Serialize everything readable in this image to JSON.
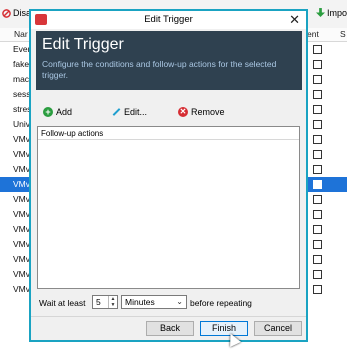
{
  "background_app": {
    "toolbar": {
      "disable_label": "Disa",
      "import_label": "Impor"
    },
    "columns": {
      "name": "Nar",
      "event": "ent",
      "s": "S"
    },
    "rows": [
      {
        "name": "Ever"
      },
      {
        "name": "fake"
      },
      {
        "name": "mac"
      },
      {
        "name": "sess"
      },
      {
        "name": "stres"
      },
      {
        "name": "Univ"
      },
      {
        "name": "VMv"
      },
      {
        "name": "VMv"
      },
      {
        "name": "VMv"
      },
      {
        "name": "VMv"
      },
      {
        "name": "VMv"
      },
      {
        "name": "VMv"
      },
      {
        "name": "VMv"
      },
      {
        "name": "VMv"
      },
      {
        "name": "VMv"
      },
      {
        "name": "VMv"
      },
      {
        "name": "VMv"
      }
    ],
    "selected_row": 9
  },
  "dialog": {
    "window_title": "Edit Trigger",
    "banner": {
      "title": "Edit Trigger",
      "subtitle": "Configure the conditions and follow-up actions for the selected trigger."
    },
    "toolbar": {
      "add_label": "Add",
      "edit_label": "Edit...",
      "remove_label": "Remove"
    },
    "list": {
      "header": "Follow-up actions"
    },
    "wait": {
      "prefix": "Wait at least",
      "value": "5",
      "unit": "Minutes",
      "suffix": "before repeating"
    },
    "buttons": {
      "back": "Back",
      "finish": "Finish",
      "cancel": "Cancel"
    }
  },
  "colors": {
    "dialog_border": "#1aa3c2",
    "banner_bg": "#2f4150",
    "banner_subtitle": "#aac7e3",
    "selection": "#1e73d8"
  }
}
